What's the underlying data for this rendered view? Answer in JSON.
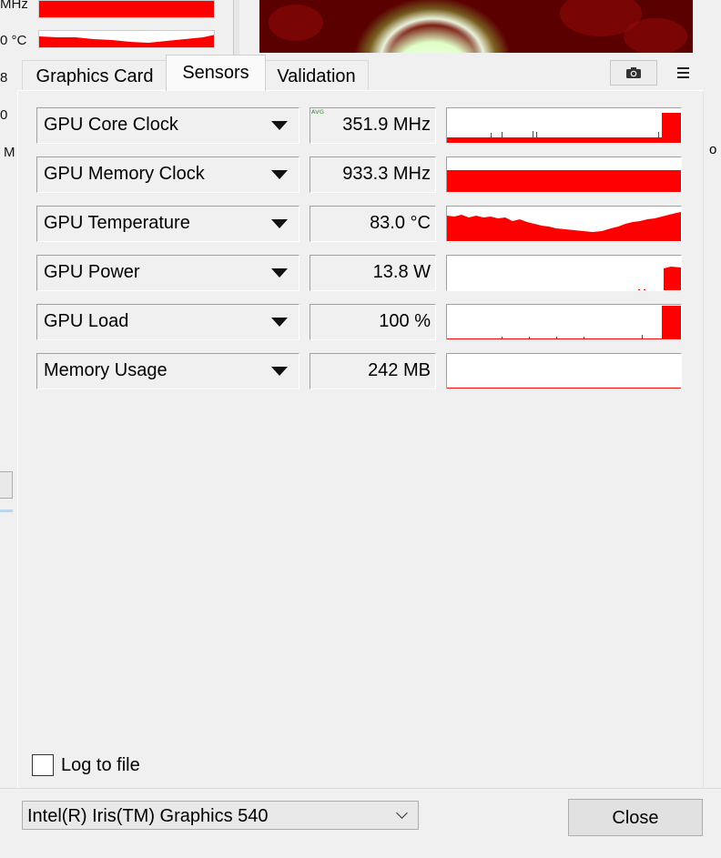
{
  "background_window": {
    "labels": [
      "MHz",
      "0 °C",
      "8",
      "0",
      "M"
    ],
    "right_letter": "o"
  },
  "tabs": [
    {
      "label": "Graphics Card",
      "active": false
    },
    {
      "label": "Sensors",
      "active": true
    },
    {
      "label": "Validation",
      "active": false
    }
  ],
  "toolbar": {
    "camera_icon": "camera-icon",
    "menu_icon": "hamburger-menu-icon"
  },
  "sensors": [
    {
      "name": "GPU Core Clock",
      "value": "351.9 MHz",
      "badge": "AVG"
    },
    {
      "name": "GPU Memory Clock",
      "value": "933.3 MHz",
      "badge": ""
    },
    {
      "name": "GPU Temperature",
      "value": "83.0 °C",
      "badge": ""
    },
    {
      "name": "GPU Power",
      "value": "13.8 W",
      "badge": ""
    },
    {
      "name": "GPU Load",
      "value": "100 %",
      "badge": ""
    },
    {
      "name": "Memory Usage",
      "value": "242 MB",
      "badge": ""
    }
  ],
  "log_to_file": {
    "label": "Log to file",
    "checked": false
  },
  "gpu_selector": {
    "selected": "Intel(R) Iris(TM) Graphics 540"
  },
  "close_button": {
    "label": "Close"
  },
  "colors": {
    "graph": "#ff0000",
    "avg_badge": "#2e8b2e"
  }
}
